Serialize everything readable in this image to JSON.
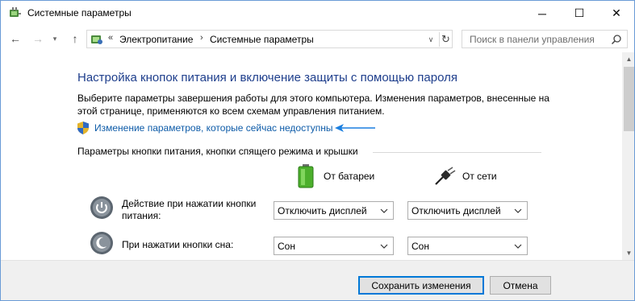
{
  "window": {
    "title": "Системные параметры",
    "minimize_glyph": "─",
    "maximize_glyph": "☐",
    "close_glyph": "✕"
  },
  "nav": {
    "back_glyph": "←",
    "forward_glyph": "→",
    "dropdown_glyph": "▾",
    "up_glyph": "↑"
  },
  "address": {
    "separator": "«",
    "crumb_sep": "›",
    "crumbs": [
      "Электропитание",
      "Системные параметры"
    ],
    "dropdown_glyph": "∨",
    "refresh_glyph": "↻"
  },
  "search": {
    "placeholder": "Поиск в панели управления"
  },
  "content": {
    "title": "Настройка кнопок питания и включение защиты с помощью пароля",
    "desc_line1": "Выберите параметры завершения работы для этого компьютера. Изменения параметров, внесенные на",
    "desc_line2": "этой странице, применяются ко всем схемам управления питанием.",
    "change_link": "Изменение параметров, которые сейчас недоступны",
    "section_header": "Параметры кнопки питания, кнопки спящего режима и крышки",
    "columns": {
      "battery": "От батареи",
      "ac": "От сети"
    },
    "rows": [
      {
        "label_line1": "Действие при нажатии кнопки",
        "label_line2": "питания:",
        "battery_value": "Отключить дисплей",
        "ac_value": "Отключить дисплей"
      },
      {
        "label_line1": "При нажатии кнопки сна:",
        "label_line2": "",
        "battery_value": "Сон",
        "ac_value": "Сон"
      }
    ]
  },
  "scrollbar": {
    "up_glyph": "▲",
    "down_glyph": "▼"
  },
  "footer": {
    "save_label": "Сохранить изменения",
    "cancel_label": "Отмена"
  },
  "colors": {
    "title_blue": "#1e3e8c",
    "link_blue": "#0d5ba8",
    "accent": "#0078d7",
    "annotation_arrow": "#1a7fe0"
  }
}
